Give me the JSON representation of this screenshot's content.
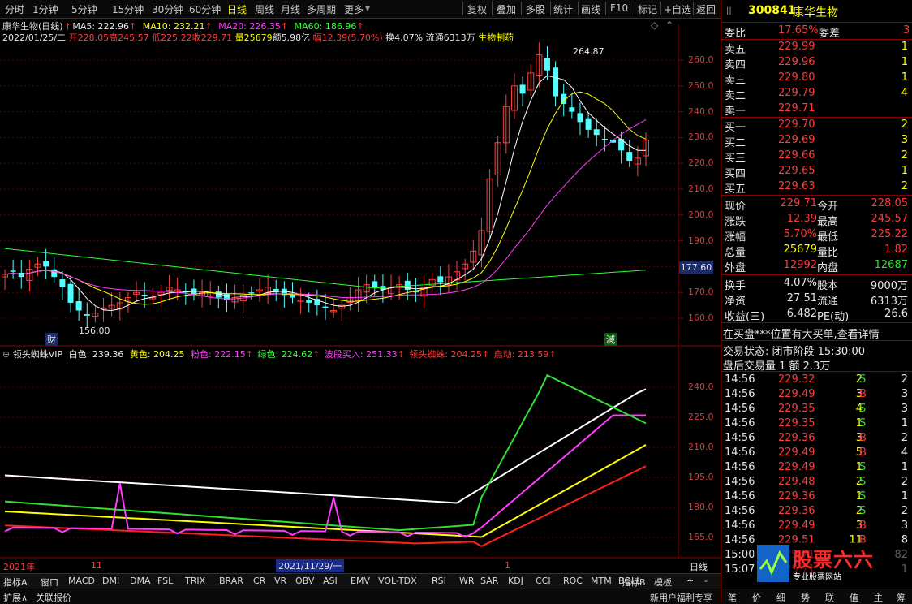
{
  "toolbar": {
    "periods": [
      "分时",
      "1分钟",
      "5分钟",
      "15分钟",
      "30分钟",
      "60分钟",
      "日线",
      "周线",
      "月线",
      "多周期",
      "更多"
    ],
    "active_period": "日线",
    "actions": [
      "复权",
      "叠加",
      "多股",
      "统计",
      "画线",
      "F10",
      "标记",
      "+自选",
      "返回"
    ]
  },
  "header": {
    "name": "康华生物(日线)",
    "ma5": "MA5: 222.96",
    "ma10": "MA10: 232.21",
    "ma20": "MA20: 226.35",
    "ma60": "MA60: 186.96",
    "date": "2022/01/25/二",
    "open": "开228.05",
    "high": "高245.57",
    "low": "低225.22",
    "close": "收229.71",
    "vol": "量25679",
    "amt": "额5.98亿",
    "chg": "幅12.39(5.70%)",
    "turnover": "换4.07%",
    "float": "流通6313万",
    "sector": "生物制药"
  },
  "price_axis": [
    "260.0",
    "250.0",
    "240.0",
    "230.0",
    "220.0",
    "210.0",
    "200.0",
    "190.0",
    "180.0",
    "170.0",
    "160.0"
  ],
  "current_price_tag": "177.60",
  "annotations": {
    "high": "264.87",
    "low": "156.00",
    "cai": "财",
    "jian": "減"
  },
  "indicator": {
    "name": "领头蜘蛛VIP",
    "white": "白色: 239.36",
    "yellow": "黄色: 204.25",
    "pink": "粉色: 222.15",
    "green": "绿色: 224.62",
    "wave": "波段买入: 251.33",
    "spider": "领头蜘蛛: 204.25",
    "start": "启动: 213.59",
    "axis": [
      "240.0",
      "225.0",
      "210.0",
      "195.0",
      "180.0",
      "165.0"
    ]
  },
  "time_axis": {
    "y2021": "2021年",
    "m11": "11",
    "sel": "2021/11/29/一",
    "m1": "1",
    "period": "日线"
  },
  "bottom_tabs": [
    "指标A",
    "窗口",
    "MACD",
    "DMI",
    "DMA",
    "FSL",
    "TRIX",
    "BRAR",
    "CR",
    "VR",
    "OBV",
    "ASI",
    "EMV",
    "VOL-TDX",
    "RSI",
    "WR",
    "SAR",
    "KDJ",
    "CCI",
    "ROC",
    "MTM",
    "BOLL"
  ],
  "bottom_right": [
    "指标B",
    "模板",
    "+",
    "-"
  ],
  "status": {
    "left1": "扩展∧",
    "left2": "关联报价",
    "right": "新用户福利专享",
    "b1": "笔",
    "b2": "价",
    "b3": "细",
    "b4": "势",
    "b5": "联",
    "b6": "值",
    "b7": "主",
    "b8": "筹"
  },
  "quote": {
    "code": "300841",
    "title": "康华生物",
    "weibi_label": "委比",
    "weibi": "17.65%",
    "weicha_label": "委差",
    "weicha": "3",
    "sells": [
      {
        "label": "卖五",
        "price": "229.99",
        "vol": "1"
      },
      {
        "label": "卖四",
        "price": "229.96",
        "vol": "1"
      },
      {
        "label": "卖三",
        "price": "229.80",
        "vol": "1"
      },
      {
        "label": "卖二",
        "price": "229.79",
        "vol": "4"
      },
      {
        "label": "卖一",
        "price": "229.71",
        "vol": ""
      }
    ],
    "buys": [
      {
        "label": "买一",
        "price": "229.70",
        "vol": "2"
      },
      {
        "label": "买二",
        "price": "229.69",
        "vol": "3"
      },
      {
        "label": "买三",
        "price": "229.66",
        "vol": "2"
      },
      {
        "label": "买四",
        "price": "229.65",
        "vol": "1"
      },
      {
        "label": "买五",
        "price": "229.63",
        "vol": "2"
      }
    ],
    "stats": [
      {
        "l1": "现价",
        "v1": "229.71",
        "l2": "今开",
        "v2": "228.05"
      },
      {
        "l1": "涨跌",
        "v1": "12.39",
        "l2": "最高",
        "v2": "245.57"
      },
      {
        "l1": "涨幅",
        "v1": "5.70%",
        "l2": "最低",
        "v2": "225.22"
      },
      {
        "l1": "总量",
        "v1": "25679",
        "l2": "量比",
        "v2": "1.82"
      },
      {
        "l1": "外盘",
        "v1": "12992",
        "l2": "内盘",
        "v2": "12687"
      }
    ],
    "stats2": [
      {
        "l1": "换手",
        "v1": "4.07%",
        "l2": "股本",
        "v2": "9000万"
      },
      {
        "l1": "净资",
        "v1": "27.51",
        "l2": "流通",
        "v2": "6313万"
      },
      {
        "l1": "收益(三)",
        "v1": "6.482",
        "l2": "PE(动)",
        "v2": "26.6"
      }
    ],
    "notice": "在买盘***位置有大买单,查看详情",
    "trade_state": "交易状态: 闭市阶段 15:30:00",
    "after_hours": "盘后交易量 1 额 2.3万",
    "ticks": [
      {
        "t": "14:56",
        "p": "229.32",
        "v": "2",
        "s": "S",
        "n": "2"
      },
      {
        "t": "14:56",
        "p": "229.49",
        "v": "3",
        "s": "B",
        "n": "3"
      },
      {
        "t": "14:56",
        "p": "229.35",
        "v": "4",
        "s": "S",
        "n": "3"
      },
      {
        "t": "14:56",
        "p": "229.35",
        "v": "1",
        "s": "S",
        "n": "1"
      },
      {
        "t": "14:56",
        "p": "229.36",
        "v": "3",
        "s": "B",
        "n": "2"
      },
      {
        "t": "14:56",
        "p": "229.49",
        "v": "5",
        "s": "B",
        "n": "4"
      },
      {
        "t": "14:56",
        "p": "229.49",
        "v": "1",
        "s": "S",
        "n": "1"
      },
      {
        "t": "14:56",
        "p": "229.48",
        "v": "2",
        "s": "S",
        "n": "2"
      },
      {
        "t": "14:56",
        "p": "229.36",
        "v": "1",
        "s": "S",
        "n": "1"
      },
      {
        "t": "14:56",
        "p": "229.36",
        "v": "2",
        "s": "S",
        "n": "2"
      },
      {
        "t": "14:56",
        "p": "229.49",
        "v": "3",
        "s": "B",
        "n": "3"
      },
      {
        "t": "14:56",
        "p": "229.51",
        "v": "11",
        "s": "B",
        "n": "8"
      },
      {
        "t": "15:00",
        "p": "229.71",
        "v": "",
        "s": "",
        "n": "82"
      },
      {
        "t": "15:07",
        "p": "229.71",
        "v": "",
        "s": "",
        "n": "1"
      }
    ],
    "watermark": "股票六六",
    "watermark_sub": "专业股票网站"
  }
}
